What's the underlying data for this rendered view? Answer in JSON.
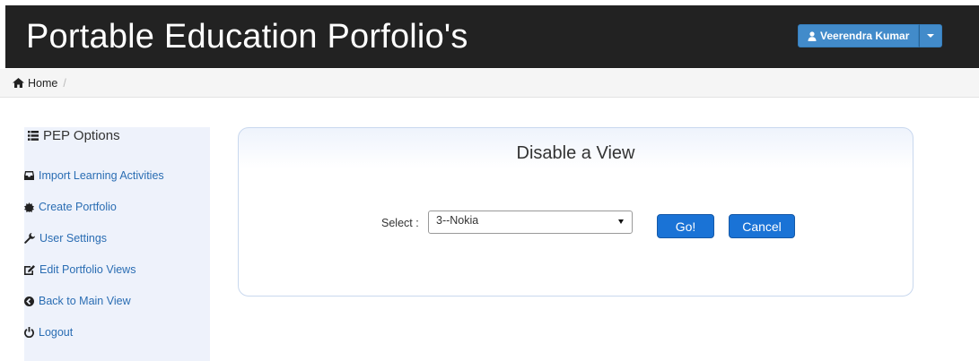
{
  "header": {
    "title": "Portable Education Porfolio's",
    "user_name": "Veerendra Kumar",
    "background": "#222222",
    "accent": "#428bca"
  },
  "breadcrumb": {
    "home_label": "Home",
    "separator": "/"
  },
  "sidebar": {
    "title": "PEP Options",
    "items": [
      {
        "label": "Import Learning Activities",
        "icon": "inbox-icon"
      },
      {
        "label": "Create Portfolio",
        "icon": "certificate-icon"
      },
      {
        "label": "User Settings",
        "icon": "wrench-icon"
      },
      {
        "label": "Edit Portfolio Views",
        "icon": "edit-icon"
      },
      {
        "label": "Back to Main View",
        "icon": "circle-arrow-left-icon"
      },
      {
        "label": "Logout",
        "icon": "power-icon"
      }
    ],
    "background": "#eef2fb",
    "link_color": "#2a6db3"
  },
  "panel": {
    "title": "Disable a View",
    "select_label": "Select :",
    "select_value": "3--Nokia",
    "go_label": "Go!",
    "cancel_label": "Cancel",
    "button_color": "#1a73d6"
  }
}
